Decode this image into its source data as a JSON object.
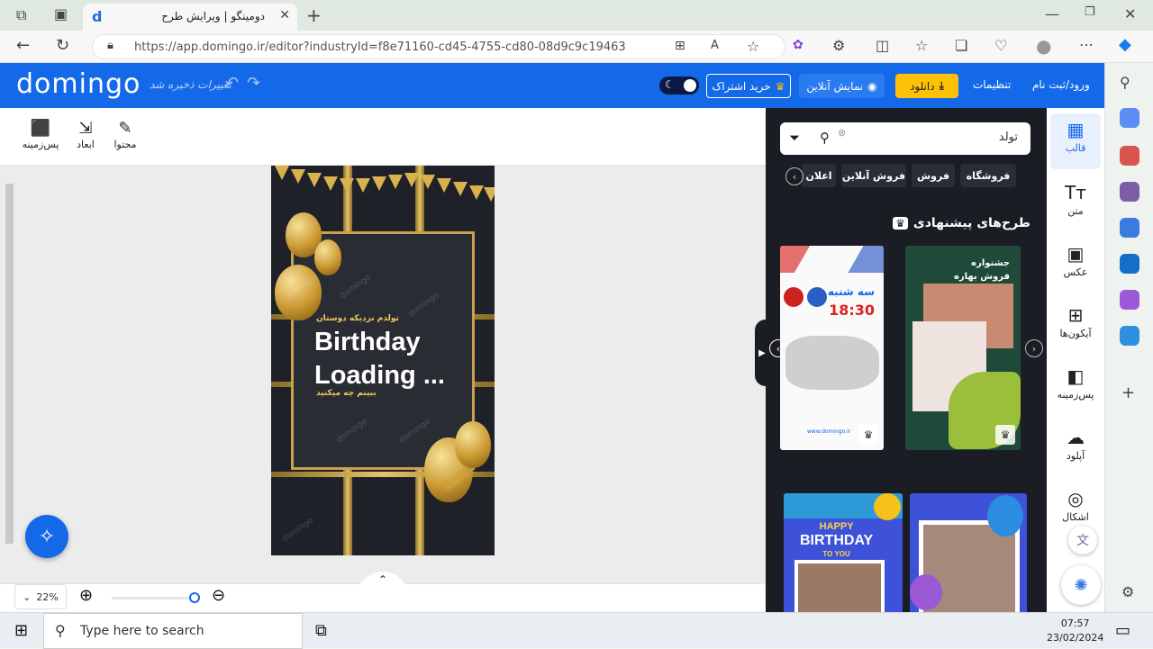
{
  "browser": {
    "tab_title": "دومینگو | ویرایش طرح",
    "url": "https://app.domingo.ir/editor?industryId=f8e71160-cd45-4755-cd80-08d9c9c19463"
  },
  "header": {
    "logo": "domingo",
    "saved_status": "تغییرات ذخیره شد",
    "buy_subscription": "خرید اشتراک",
    "online_preview": "نمایش آنلاین",
    "download": "دانلود",
    "settings": "تنظیمات",
    "login": "ورود/ثبت نام"
  },
  "toolbar": {
    "content": "محتوا",
    "dimensions": "ابعاد",
    "background": "پس‌زمینه"
  },
  "design": {
    "subtitle": "تولدم نزدیکه دوستان",
    "title_line1": "Birthday",
    "title_line2": "Loading ...",
    "cta": "ببینم چه میکنید",
    "watermark": "domingo"
  },
  "zoom": {
    "level": "22%"
  },
  "panel": {
    "search_value": "تولد",
    "chips": [
      "فروشگاه",
      "فروش",
      "فروش آنلاین",
      "اعلان"
    ],
    "section_title": "طرح‌های پیشنهادی",
    "card1": {
      "line1": "جشنواره",
      "line2": "فروش بهاره"
    },
    "card2": {
      "title": "سه شنبه",
      "time": "18:30",
      "site": "www.domingo.ir"
    },
    "card3": {
      "line1": "HAPPY",
      "line2": "BIRTHDAY",
      "line3": "TO YOU"
    }
  },
  "right_nav": {
    "items": [
      "قالب",
      "متن",
      "عکس",
      "آیکون‌ها",
      "پس‌زمینه",
      "آپلود",
      "اشکال"
    ]
  },
  "taskbar": {
    "search_placeholder": "Type here to search",
    "time": "07:57",
    "date": "23/02/2024"
  },
  "colors": {
    "brand": "#1469e8",
    "panel_bg": "#1b1d24",
    "gold": "#c7a14c",
    "download_btn": "#ffc107"
  }
}
